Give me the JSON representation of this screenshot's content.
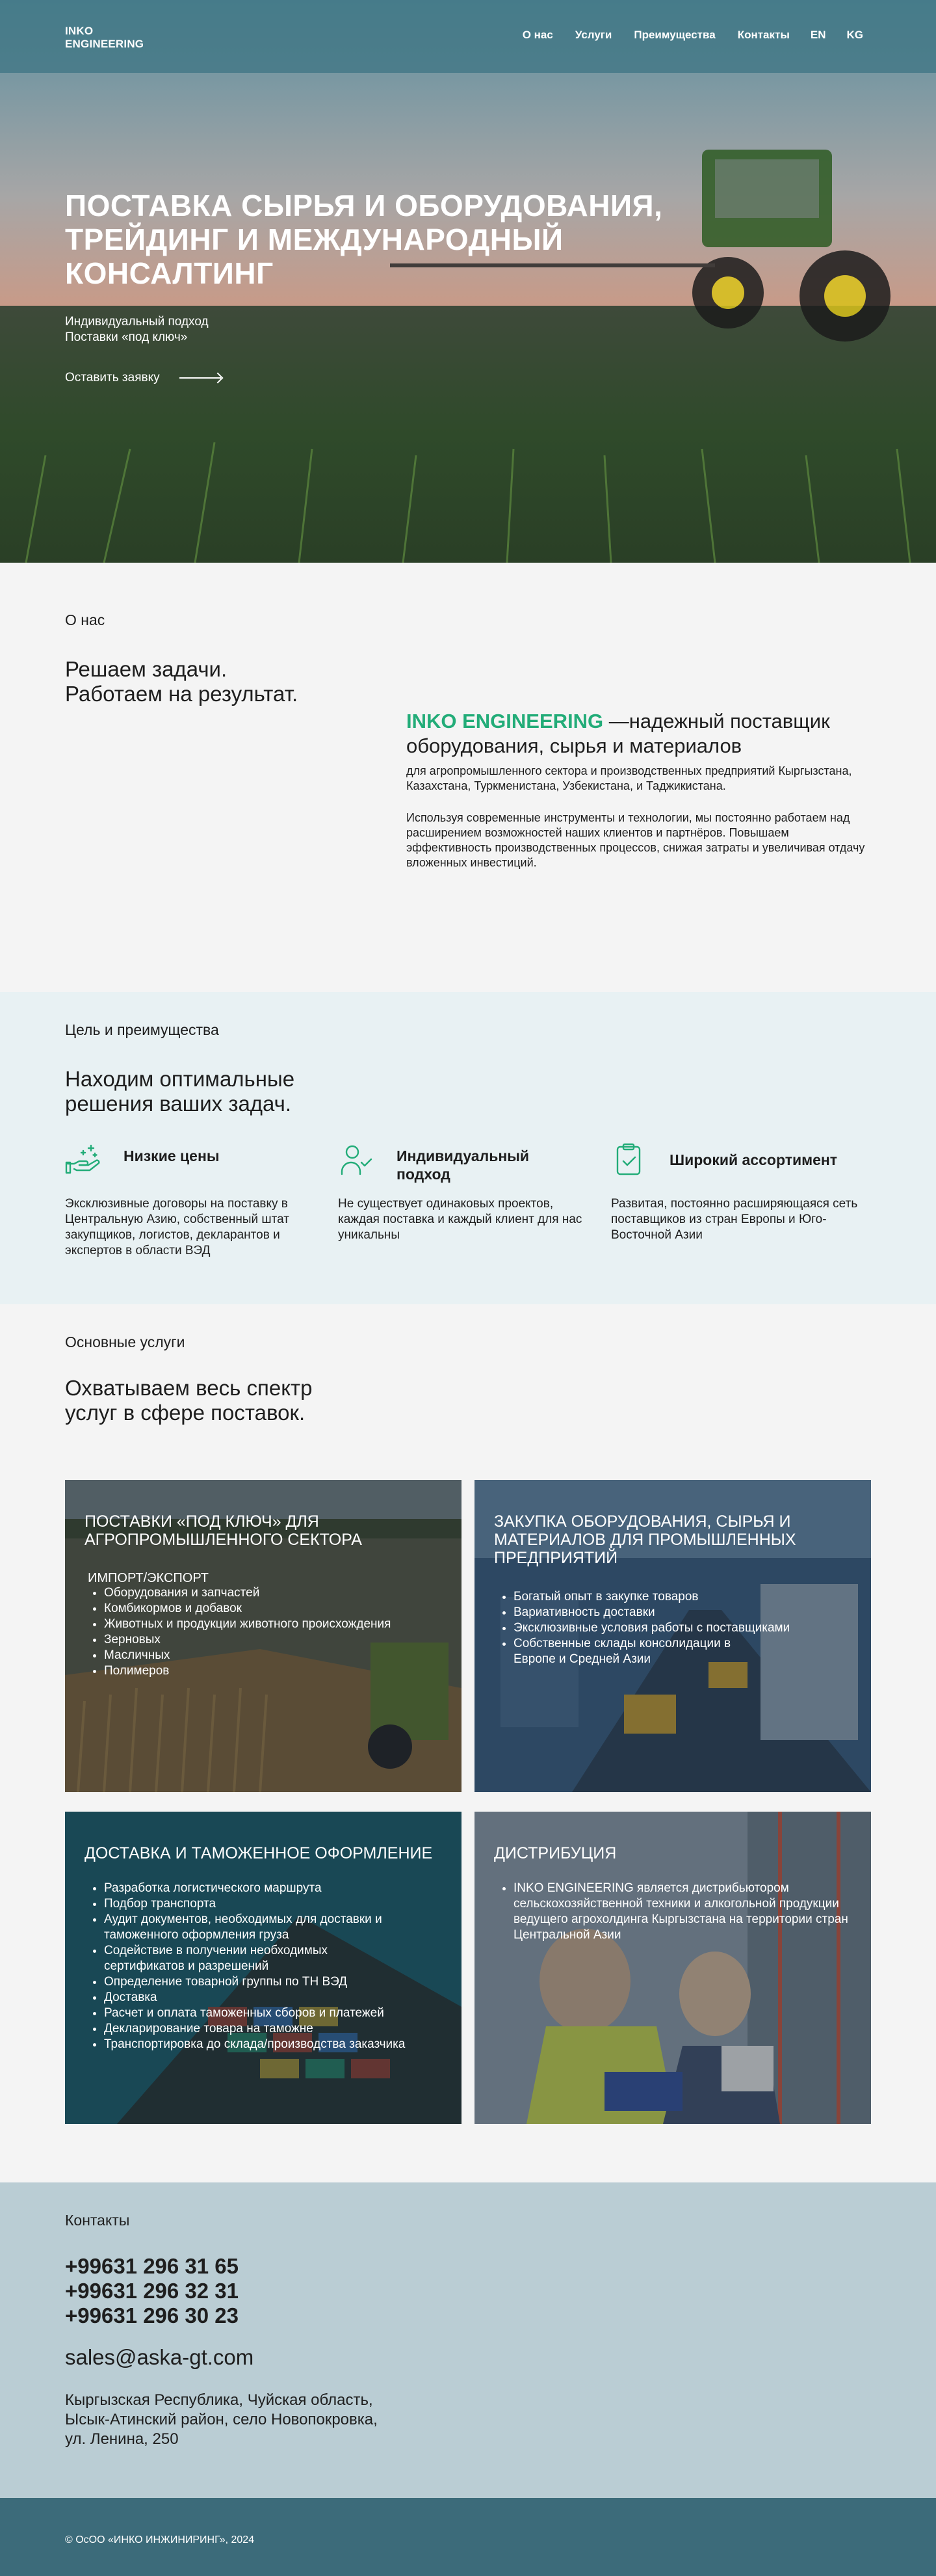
{
  "header": {
    "logo_line1": "INKO",
    "logo_line2": "ENGINEERING",
    "nav": [
      "О нас",
      "Услуги",
      "Преимущества",
      "Контакты",
      "EN",
      "KG"
    ]
  },
  "hero": {
    "title": "Поставка сырья и оборудования, трейдинг и международный консалтинг",
    "sub1": "Индивидуальный подход",
    "sub2": "Поставки «под ключ»",
    "cta": "Оставить заявку"
  },
  "about": {
    "label": "О нас",
    "heading1": "Решаем задачи.",
    "heading2": "Работаем на результат.",
    "brand": "INKO ENGINEERING",
    "tagline": " —надежный поставщик оборудования, сырья и материалов",
    "p1": "для агропромышленного сектора и производственных предприятий Кыргызстана, Казахстана, Туркменистана, Узбекистана, и Таджикистана.",
    "p2": "Используя современные инструменты и технологии, мы постоянно работаем над расширением возможностей наших клиентов и партнёров. Повышаем эффективность производственных процессов, снижая затраты и увеличивая отдачу вложенных инвестиций."
  },
  "advantages": {
    "label": "Цель и преимущества",
    "heading1": "Находим оптимальные",
    "heading2": "решения ваших задач.",
    "items": [
      {
        "icon": "hand-sparkle-icon",
        "title": "Низкие цены",
        "text": "Эксклюзивные договоры на поставку в Центральную Азию, собственный штат закупщиков, логистов, декларантов и экспертов в области ВЭД"
      },
      {
        "icon": "user-check-icon",
        "title": "Индивидуальный подход",
        "text": "Не существует одинаковых проектов, каждая поставка и каждый клиент для нас уникальны"
      },
      {
        "icon": "clipboard-check-icon",
        "title": "Широкий ассортимент",
        "text": "Развитая, постоянно расширяющаяся сеть поставщиков из стран Европы и Юго-Восточной Азии"
      }
    ],
    "accent": "#22ac78"
  },
  "services": {
    "label": "Основные услуги",
    "heading1": "Охватываем весь спектр",
    "heading2": "услуг в сфере поставок.",
    "cards": [
      {
        "title": "Поставки «под ключ» для агропромышленного сектора",
        "subtitle": "Импорт/экспорт",
        "items": [
          "Оборудования и запчастей",
          "Комбикормов и добавок",
          "Животных и продукции животного происхождения",
          "Зерновых",
          "Масличных",
          "Полимеров"
        ]
      },
      {
        "title": "Закупка оборудования, сырья и материалов для промышленных предприятий",
        "items": [
          "Богатый опыт в закупке товаров",
          "Вариативность доставки",
          "Эксклюзивные условия работы с поставщиками",
          "Собственные склады консолидации в Европе и Средней Азии"
        ]
      },
      {
        "title": "Доставка и таможенное оформление",
        "items": [
          "Разработка логистического маршрута",
          "Подбор транспорта",
          "Аудит документов, необходимых для доставки и таможенного оформления груза",
          "Содействие в получении необходимых сертификатов и разрешений",
          "Определение товарной группы по ТН ВЭД",
          "Доставка",
          "Расчет и оплата таможенных сборов и платежей",
          "Декларирование товара на таможне",
          "Транспортировка до склада/производства заказчика"
        ]
      },
      {
        "title": "Дистрибуция",
        "items": [
          "INKO ENGINEERING является дистрибьютором сельскохозяйственной техники и алкогольной продукции ведущего агрохолдинга Кыргызстана на территории стран Центральной Азии"
        ]
      }
    ]
  },
  "contacts": {
    "label": "Контакты",
    "phones": [
      "+99631 296 31 65",
      "+99631 296 32 31",
      "+99631 296 30 23"
    ],
    "email": "sales@aska-gt.com",
    "address": [
      "Кыргызская Республика, Чуйская область,",
      "Ысык-Атинский район, село Новопокровка,",
      "ул. Ленина, 250"
    ]
  },
  "footer": {
    "copyright": "© ОсОО «ИНКО ИНЖИНИРИНГ», 2024"
  }
}
